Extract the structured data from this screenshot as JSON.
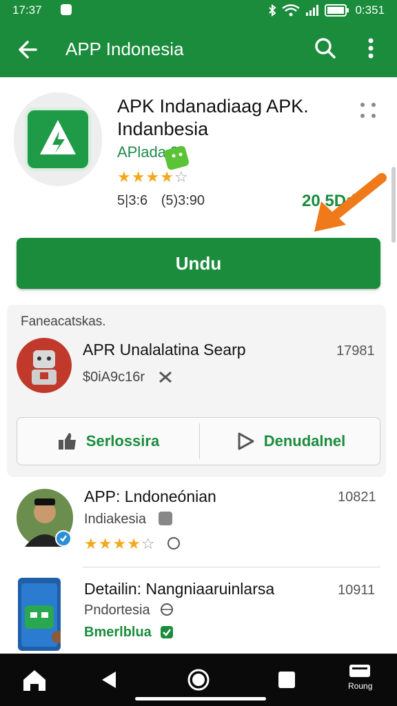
{
  "status_bar": {
    "time": "17:37",
    "battery": "0:351"
  },
  "app_bar": {
    "title": "APP Indonesia"
  },
  "app_detail": {
    "title": "APK Indanadiaag APK. Indanbesia",
    "developer": "APlada 8",
    "rating_stars": 4,
    "rating_max": 5,
    "stat_left": "5|3:6",
    "stat_right": "(5)3:90",
    "size": "20 5Dd"
  },
  "install_button": {
    "label": "Undu"
  },
  "section": {
    "heading": "Faneacatskas.",
    "item": {
      "title": "APR Unalalatina Searp",
      "subtitle": "$0iA9c16r",
      "count": "17981"
    },
    "actions": {
      "left_label": "Serlossira",
      "right_label": "Denudalnel"
    }
  },
  "list": [
    {
      "title": "APP: Lndoneónian",
      "subtitle": "Indiakesia",
      "count": "10821",
      "rating_stars": 4
    },
    {
      "title": "Detailin: Nangniaaruinlarsa",
      "subtitle": "Pndortesia",
      "subtitle2": "Bmerlblua",
      "count": "10911"
    }
  ],
  "nav_bar": {
    "label": "Roung"
  },
  "colors": {
    "primary": "#1a8c3c",
    "star": "#f4a81d",
    "arrow": "#f07a1a"
  }
}
